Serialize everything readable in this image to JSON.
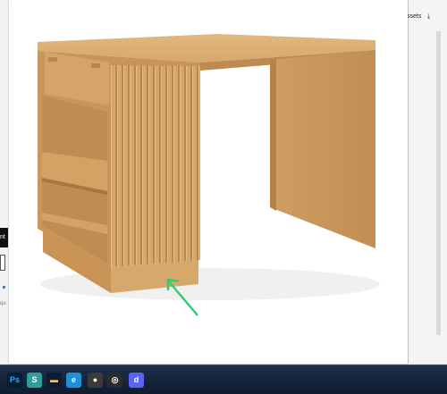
{
  "background": {
    "assets_label": "ssets",
    "download_icon": "download-icon",
    "left_tab_text": "nt",
    "left_text": "qu"
  },
  "viewer": {
    "image_alt": "Wooden desk with slatted side pedestal",
    "annotation_color": "#2ecc71"
  },
  "taskbar": {
    "icons": [
      {
        "name": "photoshop-icon",
        "label": "Ps",
        "color": "#31a8ff",
        "bg": "#001e36"
      },
      {
        "name": "app-s-icon",
        "label": "S",
        "color": "#ffffff",
        "bg": "#2f9e9b"
      },
      {
        "name": "file-explorer-icon",
        "label": "▬",
        "color": "#f6c343",
        "bg": "#0f1c30"
      },
      {
        "name": "edge-browser-icon",
        "label": "e",
        "color": "#ffffff",
        "bg": "#1f8fd6"
      },
      {
        "name": "chrome-icon",
        "label": "●",
        "color": "#ffffff",
        "bg": "#3a3a3a"
      },
      {
        "name": "obs-icon",
        "label": "◎",
        "color": "#ffffff",
        "bg": "#2b2b2b"
      },
      {
        "name": "discord-icon",
        "label": "d",
        "color": "#ffffff",
        "bg": "#5865f2"
      }
    ]
  }
}
